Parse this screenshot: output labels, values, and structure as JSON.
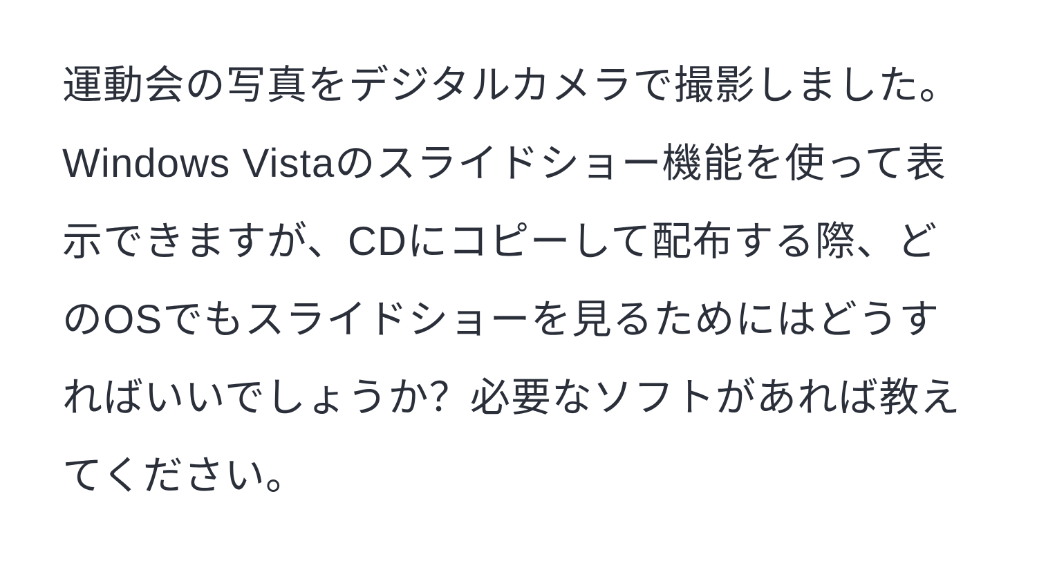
{
  "content": {
    "paragraph": "運動会の写真をデジタルカメラで撮影しました。Windows Vistaのスライドショー機能を使って表示できますが、CDにコピーして配布する際、どのOSでもスライドショーを見るためにはどうすればいいでしょうか？必要なソフトがあれば教えてください。"
  }
}
